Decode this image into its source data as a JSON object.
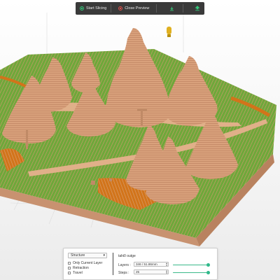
{
  "toolbar": {
    "start_slicing_label": "Start Slicing",
    "close_preview_label": "Close Preview",
    "download_icon": "download-icon",
    "export_icon": "export-icon"
  },
  "colors": {
    "accent_green": "#35c97a",
    "danger_red": "#e0504a",
    "toolbar_bg": "#3a3a3a",
    "model_tan": "#d49a70",
    "infill_green": "#6ea83a",
    "infill_orange": "#d2741a",
    "slider_fill": "#3bb98a"
  },
  "preview_panel": {
    "view_select_value": "Structure",
    "only_current_layer_label": "Only Current Layer",
    "retraction_label": "Retraction",
    "travel_label": "Travel",
    "mode_label": "tahi0 outge",
    "layers_label": "Layers :",
    "layers_value": "346 / 51.86mm",
    "steps_label": "Steps :",
    "steps_value": "25",
    "layers_progress": 1.0,
    "steps_progress": 1.0
  }
}
